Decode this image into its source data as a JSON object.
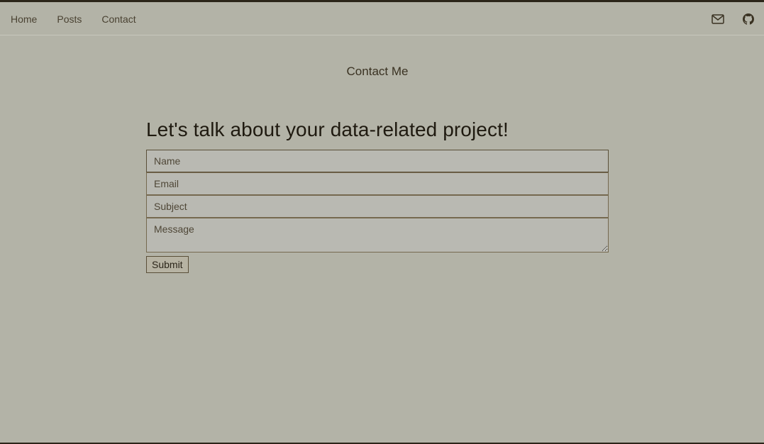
{
  "nav": {
    "links": [
      "Home",
      "Posts",
      "Contact"
    ],
    "icons": [
      "mail-icon",
      "github-icon"
    ]
  },
  "page": {
    "title": "Contact Me"
  },
  "form": {
    "heading": "Let's talk about your data-related project!",
    "name_placeholder": "Name",
    "email_placeholder": "Email",
    "subject_placeholder": "Subject",
    "message_placeholder": "Message",
    "submit_label": "Submit"
  },
  "colors": {
    "background": "#b3b3a7",
    "text": "#3a3222",
    "border": "#75694f",
    "top_bar": "#2b2519"
  }
}
